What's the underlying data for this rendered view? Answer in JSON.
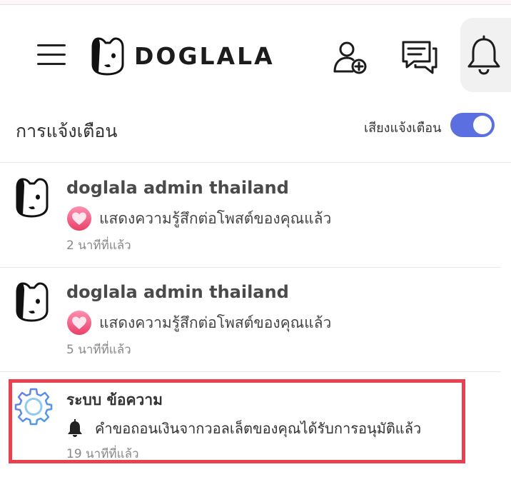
{
  "header": {
    "brand": "DOGLALA",
    "menu_icon": "hamburger-menu-icon",
    "add_friend_icon": "add-user-icon",
    "chat_icon": "chat-bubbles-icon",
    "bell_icon": "bell-icon"
  },
  "notifications_section": {
    "title": "การแจ้งเตือน",
    "sound_label": "เสียงแจ้งเตือน",
    "sound_enabled": true,
    "toggle_color": "#5b6fe0"
  },
  "notifications": [
    {
      "sender": "doglala admin thailand",
      "message": "แสดงความรู้สึกต่อโพสต์ของคุณแล้ว",
      "time": "2 นาทีที่แล้ว",
      "icon": "heart-icon"
    },
    {
      "sender": "doglala admin thailand",
      "message": "แสดงความรู้สึกต่อโพสต์ของคุณแล้ว",
      "time": "5 นาทีที่แล้ว",
      "icon": "heart-icon"
    },
    {
      "sender": "ระบบ ข้อความ",
      "message": "คำขอถอนเงินจากวอลเล็ตของคุณได้รับการอนุมัติแล้ว",
      "time": "19 นาทีที่แล้ว",
      "icon": "bell-icon"
    }
  ],
  "colors": {
    "highlight": "#e8414f",
    "heart_gradient_top": "#ff7aa2",
    "heart_gradient_bottom": "#e8416a"
  }
}
